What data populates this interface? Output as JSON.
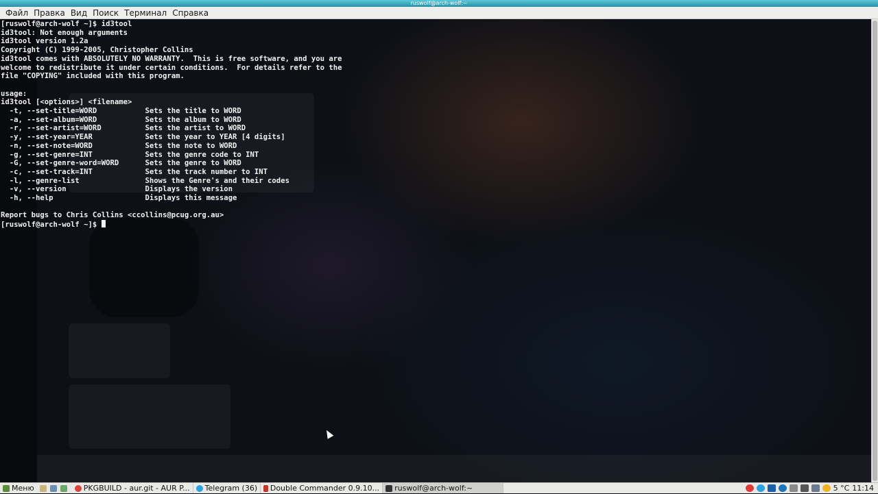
{
  "window": {
    "title": "ruswolf@arch-wolf:~"
  },
  "menu": {
    "items": [
      "Файл",
      "Правка",
      "Вид",
      "Поиск",
      "Терминал",
      "Справка"
    ]
  },
  "terminal": {
    "lines": [
      "[ruswolf@arch-wolf ~]$ id3tool",
      "id3tool: Not enough arguments",
      "id3tool version 1.2a",
      "Copyright (C) 1999-2005, Christopher Collins",
      "id3tool comes with ABSOLUTELY NO WARRANTY.  This is free software, and you are",
      "welcome to redistribute it under certain conditions.  For details refer to the",
      "file \"COPYING\" included with this program.",
      "",
      "usage:",
      "id3tool [<options>] <filename>",
      "  -t, --set-title=WORD           Sets the title to WORD",
      "  -a, --set-album=WORD           Sets the album to WORD",
      "  -r, --set-artist=WORD          Sets the artist to WORD",
      "  -y, --set-year=YEAR            Sets the year to YEAR [4 digits]",
      "  -n, --set-note=WORD            Sets the note to WORD",
      "  -g, --set-genre=INT            Sets the genre code to INT",
      "  -G, --set-genre-word=WORD      Sets the genre to WORD",
      "  -c, --set-track=INT            Sets the track number to INT",
      "  -l, --genre-list               Shows the Genre's and their codes",
      "  -v, --version                  Displays the version",
      "  -h, --help                     Displays this message",
      "",
      "Report bugs to Chris Collins <ccollins@pcug.org.au>"
    ],
    "prompt": "[ruswolf@arch-wolf ~]$ "
  },
  "taskbar": {
    "start_label": "Меню",
    "tasks": [
      {
        "label": "PKGBUILD - aur.git - AUR P...",
        "icon": "chrome-icon",
        "color": "#db4437"
      },
      {
        "label": "Telegram (36)",
        "icon": "telegram-icon",
        "color": "#2aa3df"
      },
      {
        "label": "Double Commander 0.9.10...",
        "icon": "double-commander-icon",
        "color": "#c0392b"
      },
      {
        "label": "ruswolf@arch-wolf:~",
        "icon": "terminal-icon",
        "color": "#333333"
      }
    ],
    "weather": "5 °C",
    "clock": "11:14"
  }
}
